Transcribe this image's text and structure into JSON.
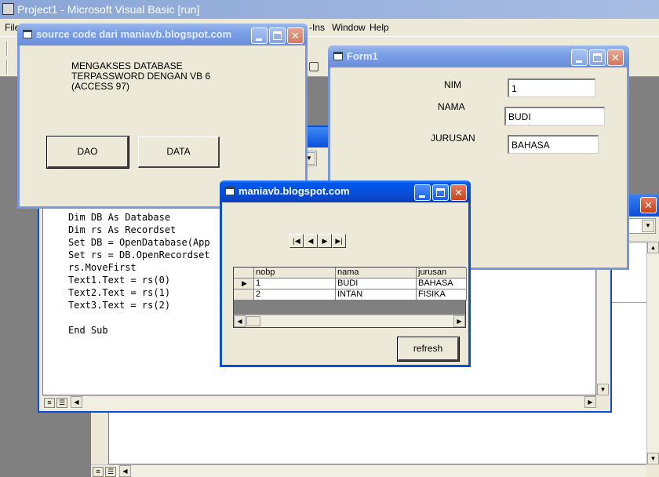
{
  "ide": {
    "title": "Project1 - Microsoft Visual Basic [run]",
    "menu": {
      "file": "File",
      "addins": "-Ins",
      "window": "Window",
      "help": "Help"
    }
  },
  "code": {
    "lines": [
      "Dim DB As Database",
      "Dim rs As Recordset",
      "Set DB = OpenDatabase(App",
      "Set rs = DB.OpenRecordset",
      "rs.MoveFirst",
      "Text1.Text = rs(0)",
      "Text2.Text = rs(1)",
      "Text3.Text = rs(2)",
      "",
      "End Sub"
    ]
  },
  "source_window": {
    "title": "source code dari maniavb.blogspot.com",
    "desc_lines": [
      "MENGAKSES DATABASE",
      "TERPASSWORD DENGAN VB 6",
      "(ACCESS 97)"
    ],
    "dao_label": "DAO",
    "data_label": "DATA"
  },
  "form1": {
    "title": "Form1",
    "nim_label": "NIM",
    "nim_value": "1",
    "nama_label": "NAMA",
    "nama_value": "BUDI",
    "jurusan_label": "JURUSAN",
    "jurusan_value": "BAHASA"
  },
  "maniavb_window": {
    "title": "maniavb.blogspot.com",
    "grid": {
      "columns": [
        "nobp",
        "nama",
        "jurusan"
      ],
      "rows": [
        [
          "1",
          "BUDI",
          "BAHASA"
        ],
        [
          "2",
          "INTAN",
          "FISIKA"
        ]
      ],
      "current_row_marker": "▶"
    },
    "refresh_label": "refresh"
  },
  "icons": {
    "nav_first": "first-record-icon",
    "nav_prev": "previous-record-icon",
    "nav_next": "next-record-icon",
    "nav_last": "last-record-icon"
  }
}
